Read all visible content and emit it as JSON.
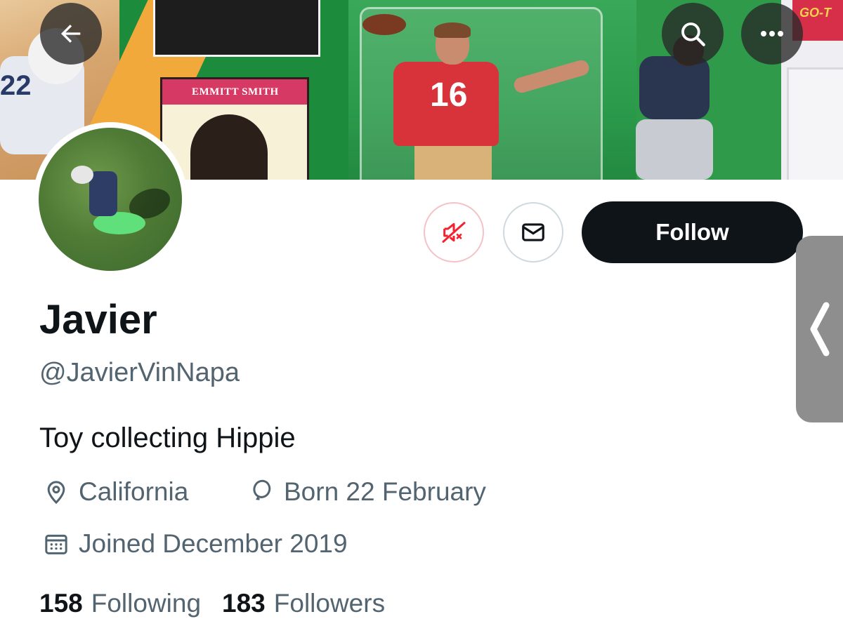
{
  "banner": {
    "card_name": "EMMITT SMITH",
    "jersey_number": "16",
    "player_number_left": "22",
    "logo_text": "GO-T"
  },
  "nav": {
    "back_icon": "arrow-left-icon",
    "search_icon": "search-icon",
    "more_icon": "more-horizontal-icon"
  },
  "actions": {
    "mute_icon": "muted-notification-icon",
    "message_icon": "mail-icon",
    "follow_label": "Follow"
  },
  "profile": {
    "name": "Javier",
    "handle": "@JavierVinNapa",
    "bio": "Toy collecting Hippie",
    "location": "California",
    "birthday": "Born 22 February",
    "joined": "Joined December 2019",
    "following_count": "158",
    "following_label": "Following",
    "followers_count": "183",
    "followers_label": "Followers"
  },
  "colors": {
    "primary_text": "#0f1419",
    "secondary_text": "#536471",
    "follow_button_bg": "#0f1419",
    "mute_accent": "#f4212e"
  }
}
